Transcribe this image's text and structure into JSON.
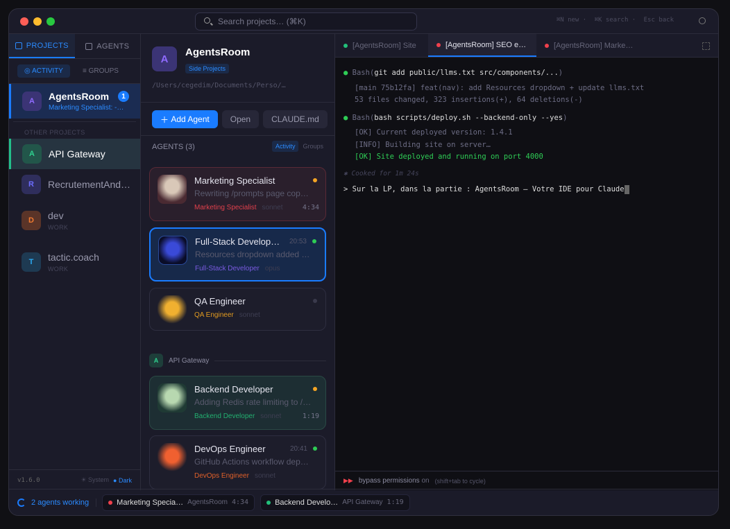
{
  "titlebar": {
    "search_placeholder": "Search projects… (⌘K)",
    "hints": [
      "⌘N new",
      "⌘K search",
      "Esc back"
    ]
  },
  "sidebar": {
    "tabs": [
      {
        "label": "PROJECTS"
      },
      {
        "label": "AGENTS"
      }
    ],
    "subtabs": [
      {
        "label": "ACTIVITY"
      },
      {
        "label": "GROUPS"
      }
    ],
    "current": {
      "initial": "A",
      "name": "AgentsRoom",
      "sub": "Marketing Specialist: -…",
      "badge": "1"
    },
    "other_label": "OTHER PROJECTS",
    "projects": [
      {
        "initial": "A",
        "name": "API Gateway",
        "group": ""
      },
      {
        "initial": "R",
        "name": "RecrutementAnd…",
        "group": ""
      },
      {
        "initial": "D",
        "name": "dev",
        "group": "WORK"
      },
      {
        "initial": "T",
        "name": "tactic.coach",
        "group": "WORK"
      }
    ],
    "version": "v1.6.0",
    "theme_system": "System",
    "theme_dark": "Dark"
  },
  "project": {
    "initial": "A",
    "name": "AgentsRoom",
    "tag": "Side Projects",
    "path": "/Users/cegedim/Documents/Perso/…",
    "add_agent": "Add Agent",
    "open": "Open",
    "claude_md": "CLAUDE.md",
    "agents_label": "AGENTS (3)",
    "view_activity": "Activity",
    "view_groups": "Groups",
    "group2_initial": "A",
    "group2_name": "API Gateway"
  },
  "agents": [
    {
      "name": "Marketing Specialist",
      "desc": "Rewriting /prompts page cop…",
      "role": "Marketing Specialist",
      "model": "sonnet",
      "time": "4:34",
      "clock": "",
      "status": "#f5a524"
    },
    {
      "name": "Full-Stack Develop…",
      "desc": "Resources dropdown added …",
      "role": "Full-Stack Developer",
      "model": "opus",
      "time": "",
      "clock": "20:53",
      "status": "#2ecc55"
    },
    {
      "name": "QA Engineer",
      "desc": "",
      "role": "QA Engineer",
      "model": "sonnet",
      "time": "",
      "clock": "",
      "status": "#3a3a4c"
    },
    {
      "name": "Backend Developer",
      "desc": "Adding Redis rate limiting to /…",
      "role": "Backend Developer",
      "model": "sonnet",
      "time": "1:19",
      "clock": "",
      "status": "#f5a524"
    },
    {
      "name": "DevOps Engineer",
      "desc": "GitHub Actions workflow dep…",
      "role": "DevOps Engineer",
      "model": "sonnet",
      "time": "",
      "clock": "20:41",
      "status": "#2ecc55"
    }
  ],
  "terminal": {
    "tabs": [
      {
        "label": "[AgentsRoom] Site"
      },
      {
        "label": "[AgentsRoom] SEO e…"
      },
      {
        "label": "[AgentsRoom] Marke…"
      }
    ],
    "lines": {
      "b1": "Bash(",
      "c1": "git add public/llms.txt src/components/...",
      "e1": ")",
      "o1": "[main 75b12fa] feat(nav): add Resources dropdown + update llms.txt",
      "o2": "53 files changed, 323 insertions(+), 64 deletions(-)",
      "b2": "Bash(",
      "c2": "bash scripts/deploy.sh --backend-only --yes",
      "e2": ")",
      "o3": "[OK] Current deployed version: 1.4.1",
      "o4": "[INFO] Building site on server…",
      "o5": "[OK] Site deployed and running on port 4000",
      "cooked": "✱ Cooked for 1m 24s",
      "prompt": "> Sur la LP, dans la partie : AgentsRoom — Votre IDE pour Claude"
    },
    "bypass": "bypass permissions",
    "bypass_on": "on",
    "bypass_hint": "(shift+tab to cycle)"
  },
  "statusbar": {
    "working": "2 agents working",
    "chips": [
      {
        "name": "Marketing Specia…",
        "project": "AgentsRoom",
        "time": "4:34"
      },
      {
        "name": "Backend Develo…",
        "project": "API Gateway",
        "time": "1:19"
      }
    ]
  }
}
